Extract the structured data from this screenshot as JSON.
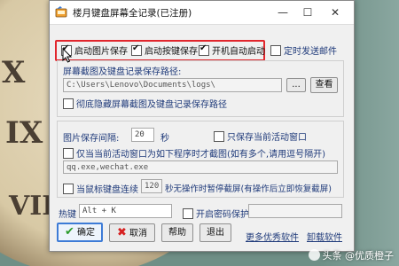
{
  "window": {
    "title": "楼月键盘屏幕全记录(已注册)",
    "controls": {
      "minimize": "—",
      "maximize": "☐",
      "close": "✕"
    }
  },
  "options": {
    "start_image_save": {
      "label": "启动图片保存",
      "checked": true
    },
    "start_key_save": {
      "label": "启动按键保存",
      "checked": true
    },
    "auto_start": {
      "label": "开机自动启动",
      "checked": true
    },
    "timed_email": {
      "label": "定时发送邮件",
      "checked": false
    }
  },
  "save_path": {
    "label": "屏幕截图及键盘记录保存路径:",
    "value": "C:\\Users\\Lenovo\\Documents\\logs\\",
    "browse_label": "...",
    "view_label": "查看",
    "hide_option": {
      "label": "彻底隐藏屏幕截图及键盘记录保存路径",
      "checked": false
    }
  },
  "interval": {
    "label": "图片保存间隔:",
    "value": "20",
    "unit": "秒",
    "only_active": {
      "label": "只保存当前活动窗口",
      "checked": false
    }
  },
  "program_filter": {
    "label": "仅当当前活动窗口为如下程序时才截图(如有多个,请用逗号隔开)",
    "checked": false,
    "value": "qq.exe,wechat.exe"
  },
  "idle": {
    "label_before": "当鼠标键盘连续",
    "value": "120",
    "label_after": "秒无操作时暂停截屏(有操作后立即恢复截屏)",
    "checked": false
  },
  "hotkey": {
    "label": "热键",
    "value": "Alt + K"
  },
  "password": {
    "label": "开启密码保护",
    "checked": false,
    "value": ""
  },
  "buttons": {
    "ok": "确定",
    "cancel": "取消",
    "help": "帮助",
    "exit": "退出"
  },
  "links": {
    "more_software": "更多优秀软件",
    "uninstall": "卸载软件"
  },
  "watermark": "头条 @优质橙子",
  "colors": {
    "highlight": "#e1262d",
    "link": "#1f3a7a",
    "ok_check": "#2b9b2b",
    "cancel_x": "#d62020"
  }
}
